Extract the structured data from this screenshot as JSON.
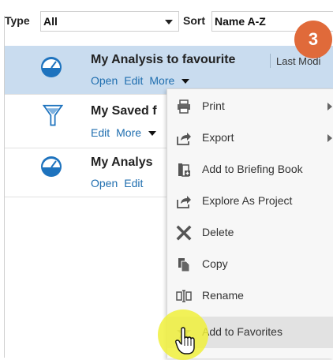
{
  "filter": {
    "type_label": "Type",
    "type_value": "All",
    "sort_label": "Sort",
    "sort_value": "Name A-Z"
  },
  "step_number": "3",
  "rows": [
    {
      "title": "My Analysis to favourite",
      "meta": "Last Modi",
      "actions": [
        "Open",
        "Edit",
        "More"
      ],
      "icon": "analysis-gauge-icon"
    },
    {
      "title": "My Saved f",
      "actions": [
        "Edit",
        "More"
      ],
      "icon": "filter-funnel-icon"
    },
    {
      "title": "My Analys",
      "actions": [
        "Open",
        "Edit"
      ],
      "icon": "analysis-gauge-icon"
    }
  ],
  "menu": {
    "items": [
      {
        "label": "Print",
        "icon": "printer-icon",
        "submenu": true
      },
      {
        "label": "Export",
        "icon": "export-icon",
        "submenu": true
      },
      {
        "label": "Add to Briefing Book",
        "icon": "briefing-book-icon",
        "submenu": false
      },
      {
        "label": "Explore As Project",
        "icon": "explore-icon",
        "submenu": false
      },
      {
        "label": "Delete",
        "icon": "delete-x-icon",
        "submenu": false
      },
      {
        "label": "Copy",
        "icon": "copy-icon",
        "submenu": false
      },
      {
        "label": "Rename",
        "icon": "rename-icon",
        "submenu": false
      },
      {
        "label": "Add to Favorites",
        "icon": "star-icon",
        "submenu": false
      }
    ]
  },
  "colors": {
    "selected_row": "#c9dcef",
    "link": "#1f6eaf",
    "badge": "#e06a3a",
    "icon_blue": "#1e73be"
  }
}
